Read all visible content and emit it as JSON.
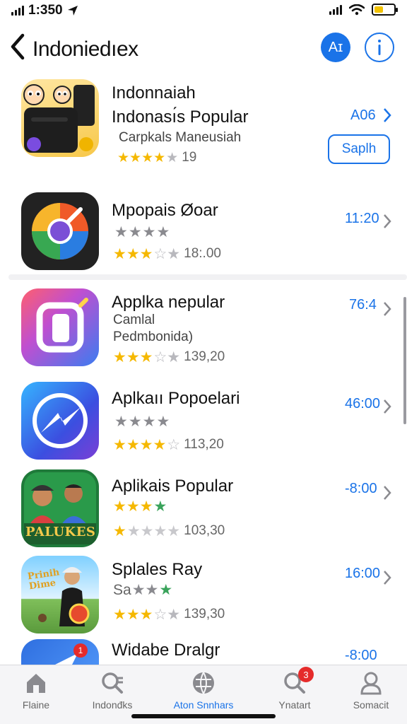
{
  "status": {
    "time": "1:350"
  },
  "nav": {
    "title": "Indoniedıex",
    "avatar_label": "Aɪ"
  },
  "apps": [
    {
      "title1": "Indonnaiah",
      "title2": "Indonası́s Popular",
      "subtitle": "Carpkals Maneusiah",
      "rating": "★★★★☆",
      "rating_count": "19",
      "price": "A06",
      "action_label": "Saplh"
    },
    {
      "title": "Mpopais Øoar",
      "rating": "★★★☆☆",
      "rating_count": "18:.00",
      "price": "11:20"
    },
    {
      "title": "Applka nepular",
      "subtitle": "Camlal",
      "subtitle2": "Pedmbonida)",
      "rating": "★★★☆☆",
      "rating_count": "139,20",
      "price": "76:4"
    },
    {
      "title": "Aplkaıı Popoelari",
      "rating": "★★★☆☆",
      "rating_count": "113,20",
      "price": "46:00"
    },
    {
      "title": "Aplikais Popular",
      "rating": "★★★☆☆",
      "rating_count": "103,30",
      "price": "-8:00",
      "icon_text": "PALUKES"
    },
    {
      "title": "Splales Ray",
      "subtitle_prefix": "Sa",
      "rating": "★★★☆☆",
      "rating_count": "139,30",
      "price": "16:00",
      "icon_text": "Prinih Dime"
    },
    {
      "title": "Widabe Dralgr",
      "price": "-8:00",
      "icon_badge": "1"
    }
  ],
  "tabs": [
    {
      "label": "Flaine",
      "icon": "home-icon"
    },
    {
      "label": "Indonđks",
      "icon": "search-list-icon"
    },
    {
      "label": "Aton Snnhars",
      "icon": "globe-icon",
      "active": true
    },
    {
      "label": "Ynatart",
      "icon": "search-icon",
      "badge": "3"
    },
    {
      "label": "Somacit",
      "icon": "person-icon"
    }
  ],
  "colors": {
    "accent": "#1a73e8",
    "star": "#f5b800",
    "badge": "#e52b2b"
  }
}
